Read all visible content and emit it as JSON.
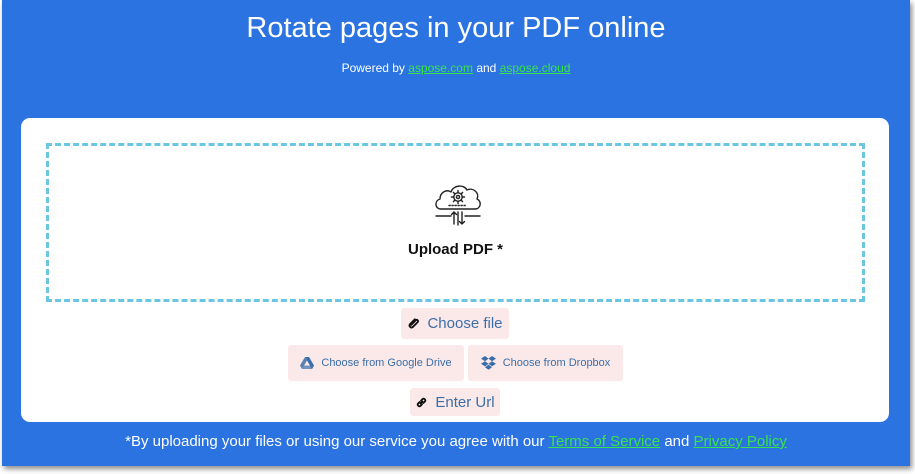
{
  "header": {
    "title": "Rotate pages in your PDF online",
    "powered_prefix": "Powered by",
    "link1": "aspose.com",
    "powered_and": "and",
    "link2": "aspose.cloud"
  },
  "upload": {
    "label": "Upload PDF *",
    "icon": "cloud-gear-upload-icon"
  },
  "buttons": {
    "choose_file": "Choose file",
    "google_drive": "Choose from Google Drive",
    "dropbox": "Choose from Dropbox",
    "enter_url": "Enter Url"
  },
  "footer": {
    "text": "*By uploading your files or using our service you agree with our",
    "terms": "Terms of Service",
    "and": "and",
    "privacy": "Privacy Policy"
  },
  "colors": {
    "background": "#2b73e0",
    "link": "#39e34c",
    "dashed_border": "#6ac6e3",
    "button_bg": "#fbe9e9",
    "button_text": "#3b6ea8"
  }
}
